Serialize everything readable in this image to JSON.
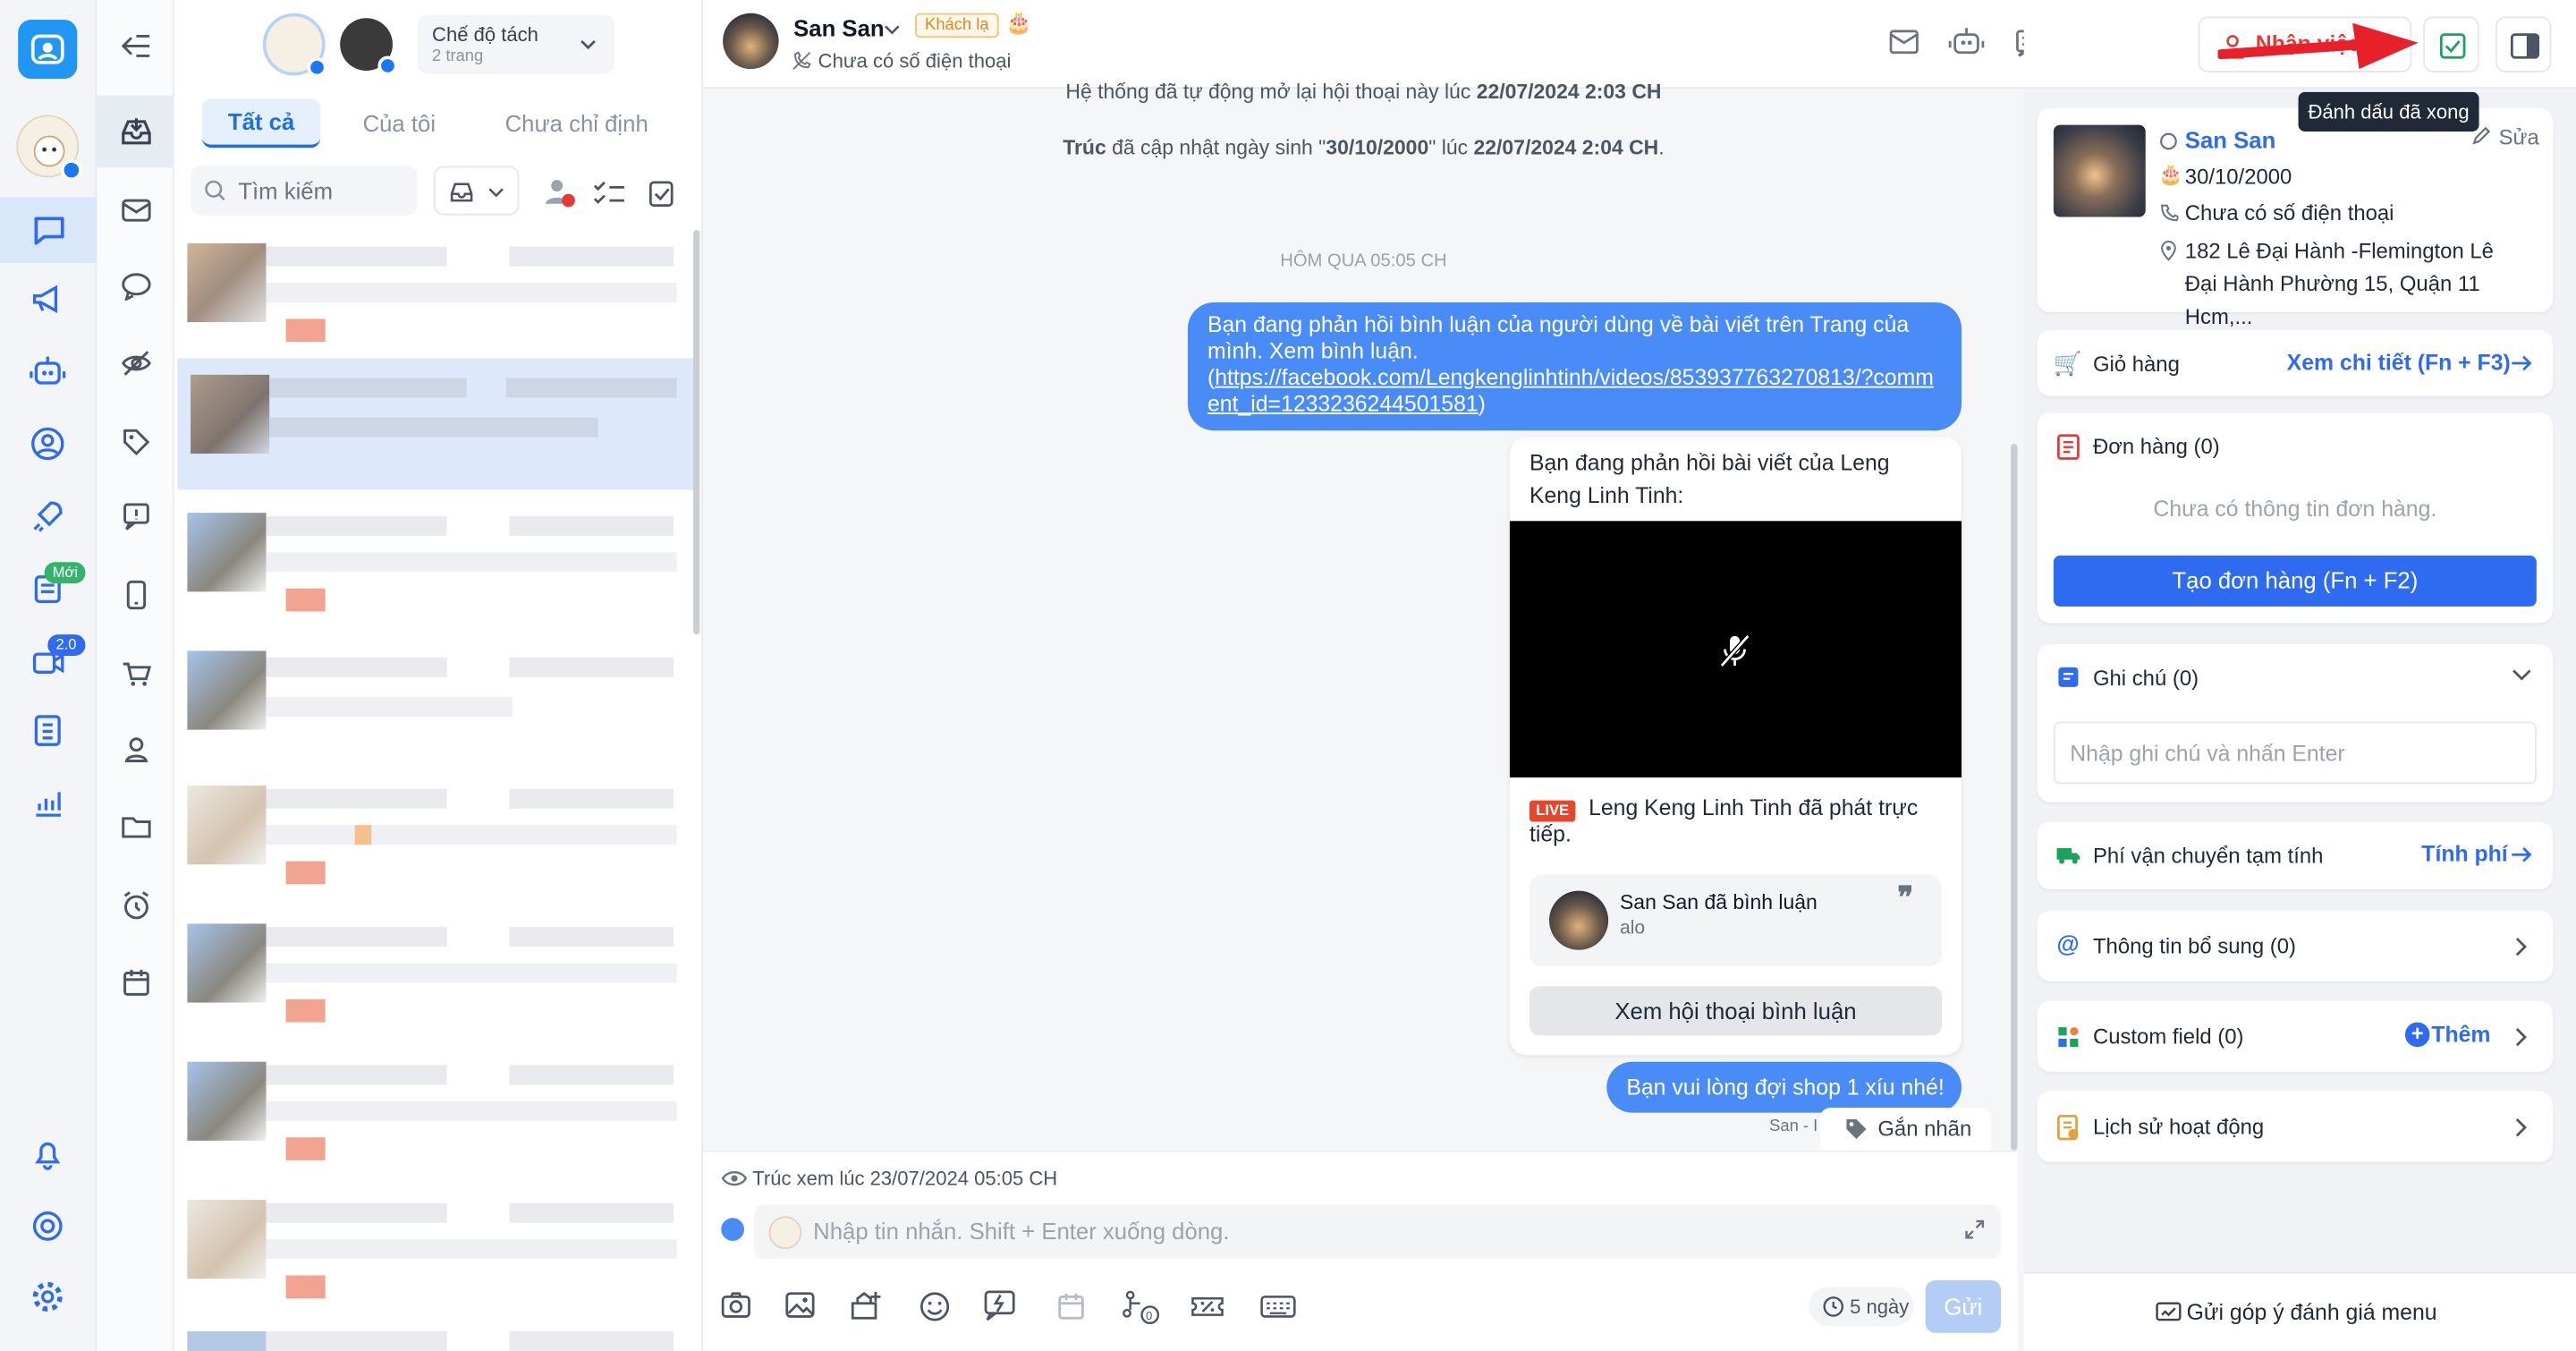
{
  "rail": {
    "new_badge": "Mới",
    "version_badge": "2.0"
  },
  "list": {
    "mode_title": "Chế độ tách",
    "mode_sub": "2 trang",
    "tabs": [
      "Tất cả",
      "Của tôi",
      "Chưa chỉ định"
    ],
    "search_placeholder": "Tìm kiếm"
  },
  "chat": {
    "contact_name": "San San",
    "contact_tag": "Khách lạ",
    "contact_phone": "Chưa có số điện thoại",
    "assign_label": "Nhận việc",
    "tooltip": "Đánh dấu đã xong",
    "sys1_prefix": "Hệ thống đã tự động mở lại hội thoại này lúc ",
    "sys1_time": "22/07/2024 2:03 CH",
    "sys2_actor": "Trúc",
    "sys2_mid": " đã cập nhật ngày sinh \"",
    "sys2_date": "30/10/2000",
    "sys2_mid2": "\" lúc ",
    "sys2_time": "22/07/2024 2:04 CH",
    "sys2_end": ".",
    "divider": "HÔM QUA 05:05 CH",
    "msg1_text": "Bạn đang phản hồi bình luận của người dùng về bài viết trên Trang của mình. Xem bình luận.",
    "msg1_link_open": "(",
    "msg1_link": "https://facebook.com/Lengkenglinhtinh/videos/853937763270813/?comment_id=1233236244501581",
    "msg1_link_close": ")",
    "card_title": "Bạn đang phản hồi bài viết của Leng Keng Linh Tinh:",
    "live_badge": "LIVE",
    "live_text": "Leng Keng Linh Tinh đã phát trực tiếp.",
    "comment_author": "San San đã bình luận",
    "comment_text": "alo",
    "view_comment_btn": "Xem hội thoại bình luận",
    "msg2_text": "Bạn vui lòng đợi shop 1 xíu nhé!",
    "msg2_meta": "San - I",
    "tag_label": "Gắn nhãn",
    "seen": "Trúc xem lúc 23/07/2024 05:05 CH",
    "input_placeholder": "Nhập tin nhắn. Shift + Enter xuống dòng.",
    "days": "5 ngày",
    "send": "Gửi"
  },
  "panel": {
    "name": "San San",
    "edit": "Sửa",
    "birthday": "30/10/2000",
    "phone": "Chưa có số điện thoại",
    "address": "182 Lê Đại Hành -Flemington Lê Đại Hành Phường 15, Quận 11 Hcm,...",
    "cart": "Giỏ hàng",
    "cart_link": "Xem chi tiết (Fn + F3)",
    "orders": "Đơn hàng (0)",
    "orders_empty": "Chưa có thông tin đơn hàng.",
    "create_order": "Tạo đơn hàng (Fn + F2)",
    "notes": "Ghi chú (0)",
    "note_placeholder": "Nhập ghi chú và nhấn Enter",
    "shipping": "Phí vận chuyển tạm tính",
    "shipping_link": "Tính phí",
    "extra": "Thông tin bổ sung (0)",
    "custom": "Custom field (0)",
    "custom_add": "Thêm",
    "history": "Lịch sử hoạt động",
    "feedback": "Gửi góp ý đánh giá menu"
  },
  "colors": {
    "primary": "#2f6bf0",
    "bubble": "#4a8cf7",
    "danger": "#e53935",
    "green": "#1aa35a"
  }
}
